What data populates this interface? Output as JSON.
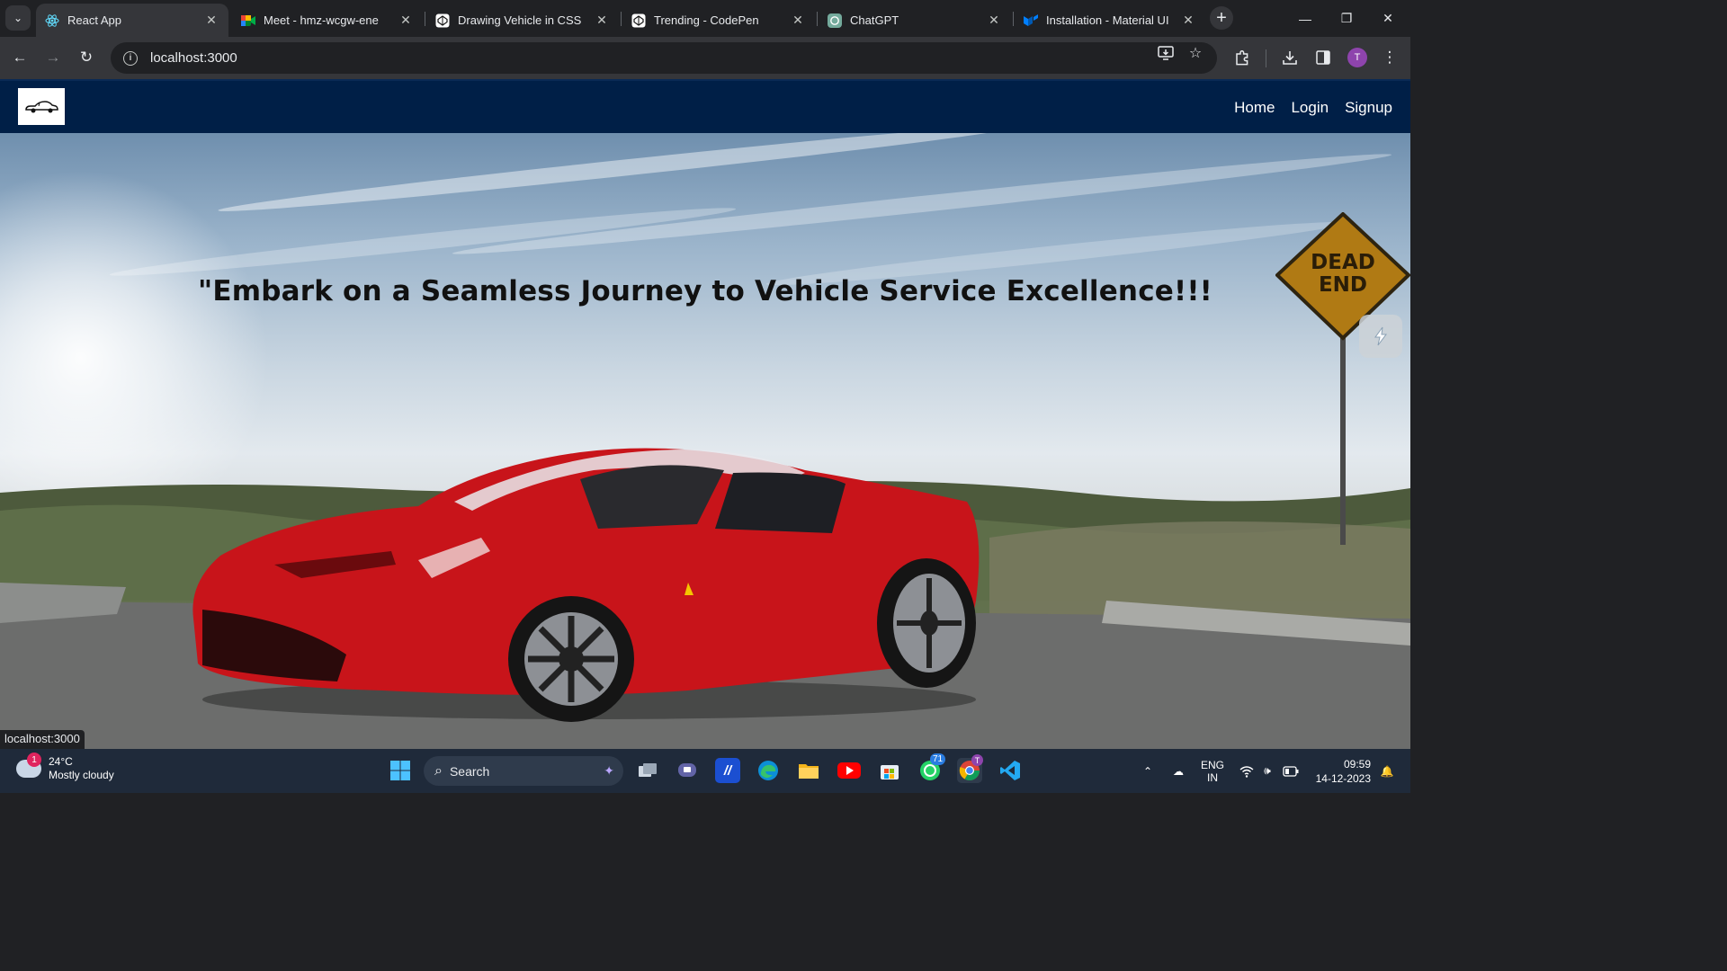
{
  "browser": {
    "tabs": [
      {
        "title": "React App",
        "active": true,
        "favicon": "react-icon",
        "color": "#61dafb"
      },
      {
        "title": "Meet - hmz-wcgw-ene",
        "active": false,
        "favicon": "google-meet-icon"
      },
      {
        "title": "Drawing Vehicle in CSS",
        "active": false,
        "favicon": "codepen-icon"
      },
      {
        "title": "Trending - CodePen",
        "active": false,
        "favicon": "codepen-icon"
      },
      {
        "title": "ChatGPT",
        "active": false,
        "favicon": "chatgpt-icon"
      },
      {
        "title": "Installation - Material UI",
        "active": false,
        "favicon": "material-ui-icon"
      }
    ],
    "url": "localhost:3000",
    "profile_initial": "T"
  },
  "app": {
    "nav_links": [
      "Home",
      "Login",
      "Signup"
    ],
    "nav_background": "#001f47",
    "hero_title": "\"Embark on a Seamless Journey to Vehicle Service Excellence!!!",
    "sign_text_line1": "DEAD",
    "sign_text_line2": "END",
    "status_url": "localhost:3000"
  },
  "taskbar": {
    "weather_badge": "1",
    "temperature": "24°C",
    "condition": "Mostly cloudy",
    "search_placeholder": "Search",
    "whatsapp_badge": "71",
    "chrome_badge": "T",
    "lang_line1": "ENG",
    "lang_line2": "IN",
    "time": "09:59",
    "date": "14-12-2023"
  }
}
